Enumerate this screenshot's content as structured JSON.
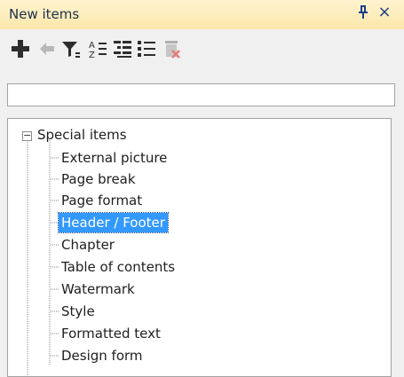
{
  "panel": {
    "title": "New items",
    "pin_glyph": "ᵖ",
    "close_glyph": "×"
  },
  "toolbar": {
    "buttons": [
      {
        "icon": "add-icon",
        "enabled": true
      },
      {
        "icon": "back-arrow-icon",
        "enabled": false
      },
      {
        "icon": "filter-icon",
        "enabled": true
      },
      {
        "icon": "sort-az-icon",
        "enabled": true
      },
      {
        "icon": "tree-view-icon",
        "enabled": true
      },
      {
        "icon": "list-view-icon",
        "enabled": true
      },
      {
        "icon": "delete-icon",
        "enabled": false
      }
    ]
  },
  "search": {
    "value": "",
    "placeholder": ""
  },
  "tree": {
    "root": {
      "label": "Special items",
      "expanded": true,
      "toggle_glyph": "−"
    },
    "items": [
      {
        "label": "External picture",
        "selected": false
      },
      {
        "label": "Page break",
        "selected": false
      },
      {
        "label": "Page format",
        "selected": false
      },
      {
        "label": "Header / Footer",
        "selected": true
      },
      {
        "label": "Chapter",
        "selected": false
      },
      {
        "label": "Table of contents",
        "selected": false
      },
      {
        "label": "Watermark",
        "selected": false
      },
      {
        "label": "Style",
        "selected": false
      },
      {
        "label": "Formatted text",
        "selected": false
      },
      {
        "label": "Design form",
        "selected": false
      }
    ]
  },
  "colors": {
    "header_bg": "#fbe7aa",
    "selection_bg": "#3399ff",
    "icon_blue": "#1f3f86"
  }
}
